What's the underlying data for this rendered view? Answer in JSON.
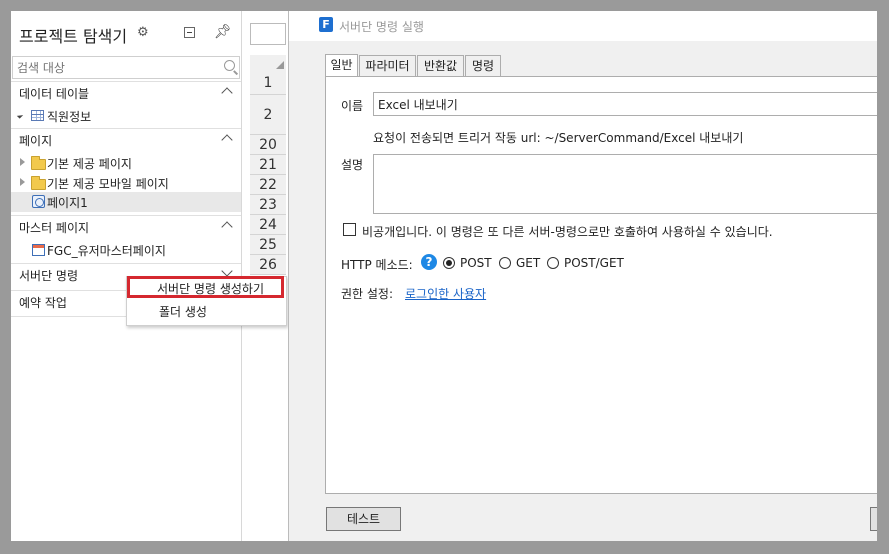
{
  "explorer": {
    "title": "프로젝트 탐색기",
    "search_placeholder": "검색 대상",
    "sections": {
      "data_tables": {
        "label": "데이터 테이블",
        "items": [
          "직원정보"
        ]
      },
      "pages": {
        "label": "페이지",
        "items": [
          "기본 제공 페이지",
          "기본 제공 모바일 페이지",
          "페이지1"
        ]
      },
      "master_pages": {
        "label": "마스터 페이지",
        "items": [
          "FGC_유저마스터페이지"
        ]
      },
      "server_commands": {
        "label": "서버단 명령"
      },
      "scheduled_tasks": {
        "label": "예약 작업"
      }
    }
  },
  "context_menu": {
    "items": [
      "서버단 명령 생성하기",
      "폴더 생성"
    ]
  },
  "sheet": {
    "rows": [
      "1",
      "2",
      "20",
      "21",
      "22",
      "23",
      "24",
      "25",
      "26"
    ]
  },
  "dialog": {
    "app_icon_letter": "F",
    "title": "서버단 명령 실행",
    "tabs": [
      "일반",
      "파라미터",
      "반환값",
      "명령"
    ],
    "name_label": "이름",
    "name_value": "Excel 내보내기",
    "url_text": "요청이 전송되면 트리거 작동 url: ~/ServerCommand/Excel 내보내기",
    "description_label": "설명",
    "private_checkbox_label": "비공개입니다. 이 명령은 또 다른 서버-명령으로만 호출하여 사용하실 수 있습니다.",
    "http_method_label": "HTTP 메소드:",
    "help_icon": "?",
    "http_methods": [
      "POST",
      "GET",
      "POST/GET"
    ],
    "selected_method": "POST",
    "permission_label": "권한 설정:",
    "permission_link": "로그인한 사용자",
    "test_button": "테스트"
  },
  "colors": {
    "highlight_border": "#d5282f",
    "link": "#1a64c8",
    "help_icon": "#1e88e5",
    "app_icon": "#1e6fd0"
  }
}
